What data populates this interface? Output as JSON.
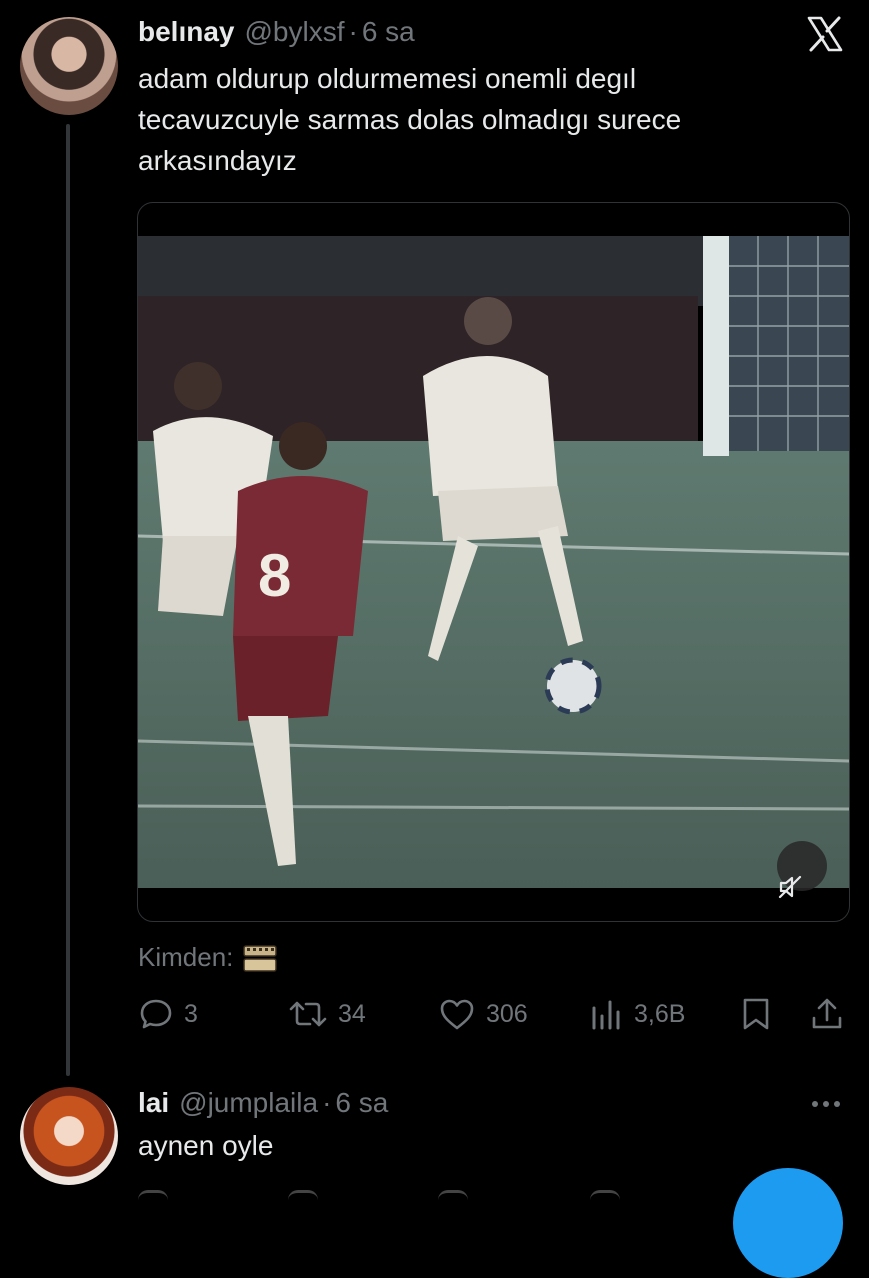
{
  "tweet": {
    "display_name": "belınay",
    "handle": "@bylxsf",
    "separator": "·",
    "time": "6 sa",
    "lines": [
      "adam oldurup oldurmemesi onemli degıl",
      "tecavuzcuyle sarmas dolas olmadıgı surece",
      "arkasındayız"
    ],
    "from_label": "Kimden:",
    "media": {
      "player_number": "8",
      "muted": true
    },
    "stats": {
      "replies": "3",
      "reposts": "34",
      "likes": "306",
      "views": "3,6B"
    }
  },
  "reply": {
    "display_name": "lai",
    "handle": "@jumplaila",
    "separator": "·",
    "time": "6 sa",
    "text": "aynen oyle"
  },
  "icons": {
    "logo": "x-logo-icon",
    "reply": "comment-icon",
    "repost": "repost-icon",
    "like": "heart-icon",
    "views": "views-icon",
    "bookmark": "bookmark-icon",
    "share": "share-icon",
    "mute": "volume-muted-icon",
    "more": "more-dots-icon",
    "film": "film-strip-icon"
  },
  "colors": {
    "background": "#000000",
    "text": "#e7e9ea",
    "muted": "#71767b",
    "accent": "#1d9bf0"
  }
}
